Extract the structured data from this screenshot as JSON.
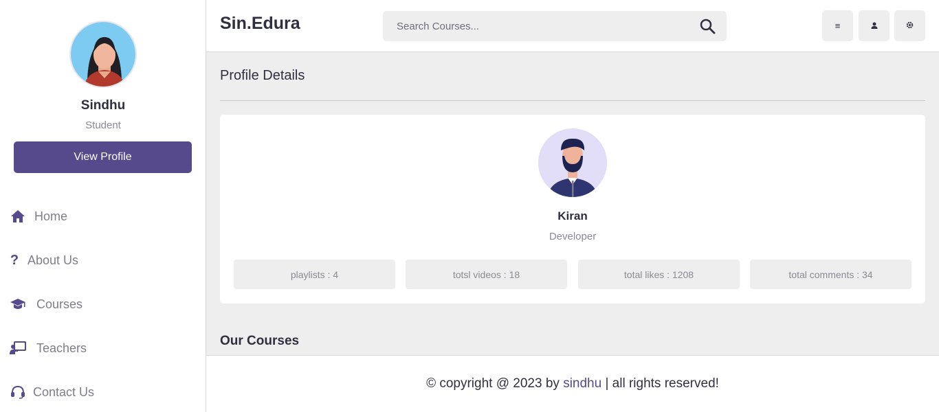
{
  "colors": {
    "accent": "#564a8c",
    "page_bg": "#eeeeee",
    "panel_bg": "#ffffff",
    "muted_text": "#8a8a96"
  },
  "sidebar": {
    "avatar_icon": "female-student-avatar",
    "name": "Sindhu",
    "role": "Student",
    "view_profile_label": "View Profile",
    "nav": [
      {
        "label": "Home",
        "icon": "home-icon"
      },
      {
        "label": "About Us",
        "icon": "question-icon"
      },
      {
        "label": "Courses",
        "icon": "graduation-cap-icon"
      },
      {
        "label": "Teachers",
        "icon": "chalkboard-teacher-icon"
      },
      {
        "label": "Contact Us",
        "icon": "headset-icon"
      }
    ]
  },
  "header": {
    "logo": "Sin.Edura",
    "search": {
      "placeholder": "Search Courses..."
    },
    "buttons": [
      {
        "icon": "menu-icon",
        "glyph": "≡"
      },
      {
        "icon": "user-icon"
      },
      {
        "icon": "gear-icon"
      }
    ]
  },
  "main": {
    "section_title": "Profile Details",
    "profile": {
      "avatar_icon": "male-developer-avatar",
      "name": "Kiran",
      "role": "Developer",
      "stats": [
        "playlists : 4",
        "totsl videos : 18",
        "total likes : 1208",
        "total comments : 34"
      ]
    },
    "courses_title": "Our Courses"
  },
  "footer": {
    "prefix": "© copyright @ 2023 by ",
    "author": "sindhu",
    "suffix": " | all rights reserved!"
  }
}
